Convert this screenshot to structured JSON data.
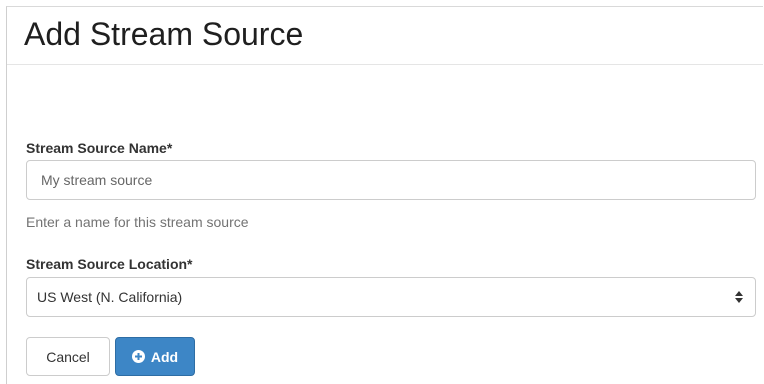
{
  "dialog": {
    "title": "Add Stream Source"
  },
  "form": {
    "name_label": "Stream Source Name*",
    "name_placeholder": "My stream source",
    "name_value": "",
    "name_help": "Enter a name for this stream source",
    "location_label": "Stream Source Location*",
    "location_selected": "US West (N. California)",
    "location_arrow_icon": "select-updown-icon"
  },
  "actions": {
    "cancel_label": "Cancel",
    "add_label": "Add",
    "add_icon": "plus-circle-icon",
    "add_color": "#3d86c6"
  }
}
